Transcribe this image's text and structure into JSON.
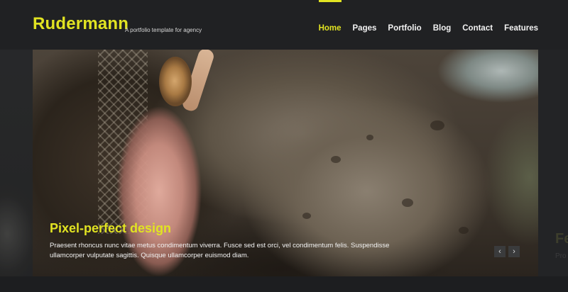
{
  "header": {
    "brand_title": "Rudermann",
    "tagline": "A portfolio template for agency"
  },
  "nav": {
    "items": [
      {
        "label": "Home",
        "active": true
      },
      {
        "label": "Pages",
        "active": false
      },
      {
        "label": "Portfolio",
        "active": false
      },
      {
        "label": "Blog",
        "active": false
      },
      {
        "label": "Contact",
        "active": false
      },
      {
        "label": "Features",
        "active": false
      }
    ]
  },
  "slider": {
    "caption_title": "Pixel-perfect design",
    "caption_text": "Praesent rhoncus nunc vitae metus condimentum viverra. Fusce sed est orci, vel condimentum felis. Suspendisse ullamcorper vulputate sagittis. Quisque ullamcorper euismod diam.",
    "prev_icon": "chevron-left-icon",
    "next_icon": "chevron-right-icon"
  },
  "next_slide_peek": {
    "title": "Fe",
    "text": "Pro"
  },
  "colors": {
    "accent": "#e1e322",
    "header_bg": "#202123",
    "page_bg": "#1b1c1e"
  }
}
